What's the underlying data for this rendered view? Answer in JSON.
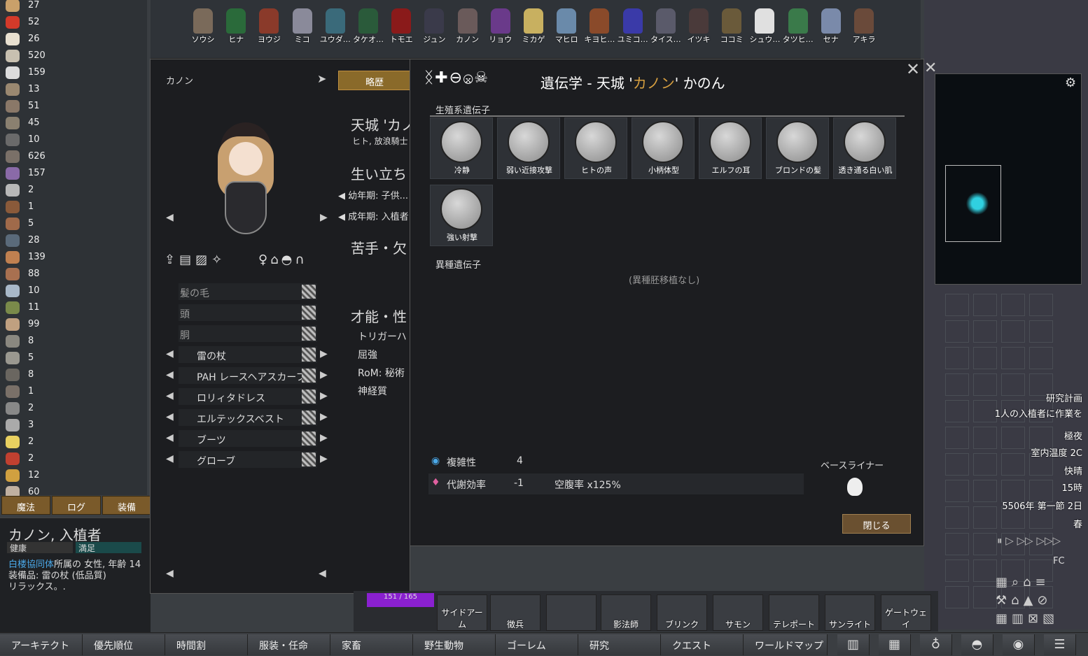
{
  "resources": [
    {
      "value": "27",
      "color": "#c9a06a"
    },
    {
      "value": "52",
      "color": "#d43a2a"
    },
    {
      "value": "26",
      "color": "#e8e0d0"
    },
    {
      "value": "520",
      "color": "#c8c0b0"
    },
    {
      "value": "159",
      "color": "#dcdcdc"
    },
    {
      "value": "13",
      "color": "#9a8870"
    },
    {
      "value": "51",
      "color": "#8a7868"
    },
    {
      "value": "45",
      "color": "#8a8070"
    },
    {
      "value": "10",
      "color": "#6a6a6a"
    },
    {
      "value": "626",
      "color": "#7a7068"
    },
    {
      "value": "157",
      "color": "#8a6aa8"
    },
    {
      "value": "2",
      "color": "#b8b8b8"
    },
    {
      "value": "1",
      "color": "#8a5a3a"
    },
    {
      "value": "5",
      "color": "#a06a4a"
    },
    {
      "value": "28",
      "color": "#5a6a7a"
    },
    {
      "value": "139",
      "color": "#c08050"
    },
    {
      "value": "88",
      "color": "#a87050"
    },
    {
      "value": "10",
      "color": "#a8b8c8"
    },
    {
      "value": "11",
      "color": "#7a8a4a"
    },
    {
      "value": "99",
      "color": "#c0a080"
    },
    {
      "value": "8",
      "color": "#8a8880"
    },
    {
      "value": "5",
      "color": "#9a9890"
    },
    {
      "value": "8",
      "color": "#6a6660"
    },
    {
      "value": "1",
      "color": "#7a7068"
    },
    {
      "value": "2",
      "color": "#888"
    },
    {
      "value": "3",
      "color": "#aaa"
    },
    {
      "value": "2",
      "color": "#e8d060"
    },
    {
      "value": "2",
      "color": "#c04030"
    },
    {
      "value": "12",
      "color": "#d0a040"
    },
    {
      "value": "60",
      "color": "#c0b0a0"
    }
  ],
  "colonists": [
    "ソウシ",
    "ヒナ",
    "ヨウジ",
    "ミコ",
    "ユウダ…",
    "タケオ…",
    "トモエ",
    "ジュン",
    "カノン",
    "リョウ",
    "ミカゲ",
    "マヒロ",
    "キヨヒ…",
    "ユミコ…",
    "タイス…",
    "イツキ",
    "ココミ",
    "シュウ…",
    "タツヒ…",
    "セナ",
    "アキラ"
  ],
  "left_tabs": [
    "魔法",
    "ログ",
    "装備"
  ],
  "inspect": {
    "name": "カノン, 入植者",
    "health_label": "健康",
    "mood_label": "満足",
    "faction": "白楼協同体",
    "faction_suffix": "所属の 女性, 年齢 14",
    "equipment": "装備品: 雷の杖 (低品質)",
    "status": "リラックス。."
  },
  "char_panel": {
    "name": "カノン",
    "tab_bio": "略歴",
    "full_name": "天城 'カノ",
    "race_line": "ヒト, 放浪騎士",
    "backstory_header": "生い立ち",
    "child": "幼年期: 子供...",
    "adult": "成年期: 入植者",
    "incapable_header": "苦手・欠",
    "traits_header": "才能・性",
    "traits": [
      "トリガーハ",
      "屈強",
      "RoM: 秘術",
      "神経質"
    ],
    "apparel": [
      "髪の毛",
      "頭",
      "胴",
      "雷の杖",
      "PAH レースヘアスカーフ",
      "ロリィタドレス",
      "エルテックスベスト",
      "ブーツ",
      "グローブ"
    ]
  },
  "genes_panel": {
    "title_prefix": "遺伝学 - 天城 '",
    "title_name": "カノン",
    "title_suffix": "' かのん",
    "germline_header": "生殖系遺伝子",
    "germline": [
      "冷静",
      "弱い近接攻撃",
      "ヒトの声",
      "小柄体型",
      "エルフの耳",
      "ブロンドの髪",
      "透き通る白い肌",
      "強い射撃"
    ],
    "xeno_header": "異種遺伝子",
    "xeno_empty": "(異種胚移植なし)",
    "complexity_label": "複雑性",
    "complexity_value": "4",
    "metabolism_label": "代謝効率",
    "metabolism_value": "-1",
    "hunger": "空腹率 x125%",
    "baseliner": "ベースライナー",
    "close": "閉じる"
  },
  "right_info": {
    "research": "研究計画",
    "research_sub": "1人の入植者に作業を",
    "time1": "極夜",
    "temp": "室内温度 2C",
    "weather": "快晴",
    "hour": "15時",
    "date": "5506年 第一節 2日",
    "season": "春",
    "fc": "FC"
  },
  "architect_items": [
    "サイドアーム",
    "徴兵",
    "",
    "影法師",
    "ブリンク",
    "サモン",
    "テレポート",
    "サンライト",
    "ゲートウェイ"
  ],
  "mana": "151 / 165",
  "bottom_tabs": [
    "アーキテクト",
    "優先順位",
    "時間割",
    "服装・任命",
    "家畜",
    "野生動物",
    "ゴーレム",
    "研究",
    "クエスト",
    "ワールドマップ"
  ],
  "colors": {
    "accent": "#d8a040",
    "tab": "#7a5a2a",
    "xeno_purple": "#8a20d0",
    "link": "#4aa8e8"
  }
}
